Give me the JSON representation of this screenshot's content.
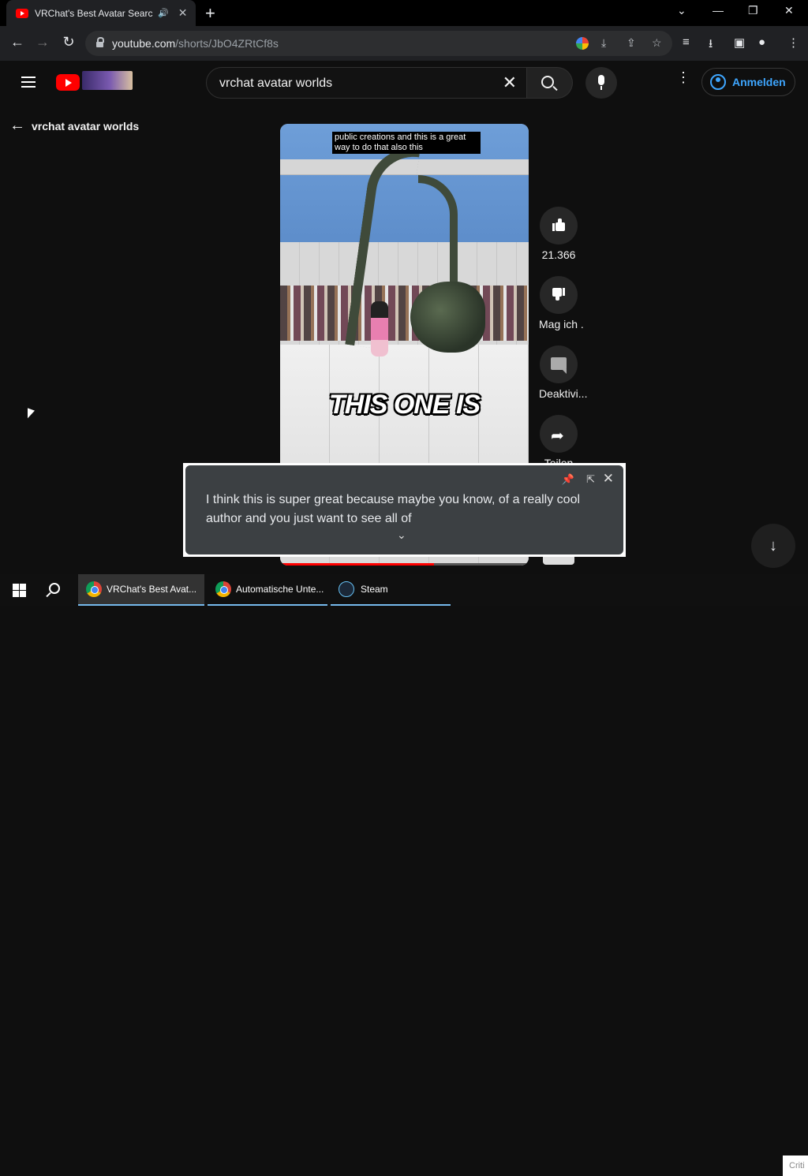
{
  "browser": {
    "tab_title": "VRChat's Best Avatar Search",
    "tab_audio": "🔊",
    "tab_close": "✕",
    "new_tab": "+",
    "window_controls": {
      "dropdown": "⌄",
      "minimize": "—",
      "restore": "❐",
      "close": "✕"
    },
    "nav": {
      "back": "←",
      "forward": "→",
      "reload": "↻"
    },
    "url_domain": "youtube.com",
    "url_path": "/shorts/JbO4ZRtCf8s",
    "omnibox_icons": [
      "google-lens-icon",
      "install-icon",
      "share-icon",
      "star-icon"
    ],
    "toolbar_icons": [
      "media-queue-icon",
      "download-icon",
      "side-panel-icon",
      "profile-icon",
      "menu-icon"
    ]
  },
  "youtube": {
    "search_value": "vrchat avatar worlds",
    "search_clear": "✕",
    "signin_label": "Anmelden",
    "kebab": "⋮",
    "back_label": "vrchat avatar worlds",
    "back_arrow": "←"
  },
  "short": {
    "top_caption": "public creations and this is a great way to do that also this",
    "overlay_text": "THIS ONE IS",
    "progress_fraction": 0.62
  },
  "actions": {
    "like_count": "21.366",
    "dislike_label": "Mag ich .",
    "comments_label": "Deaktivi...",
    "share_label": "Teilen",
    "share_glyph": "➦"
  },
  "live_caption": {
    "text": "I think this is super great because maybe you know, of a really cool author and you just want to see all of",
    "pin": "📌",
    "expand": "⇱",
    "close": "✕",
    "chevron": "⌄"
  },
  "scroll_down": "↓",
  "taskbar": {
    "items": [
      {
        "label": "VRChat's Best Avat...",
        "icon": "chrome-icon",
        "active": true
      },
      {
        "label": "Automatische Unte...",
        "icon": "chrome-icon",
        "active": false
      },
      {
        "label": "Steam",
        "icon": "steam-icon",
        "active": false
      }
    ],
    "crit_text": "Criti"
  },
  "colors": {
    "accent_blue": "#3ea6ff",
    "youtube_red": "#ff0000",
    "background": "#0f0f0f"
  }
}
